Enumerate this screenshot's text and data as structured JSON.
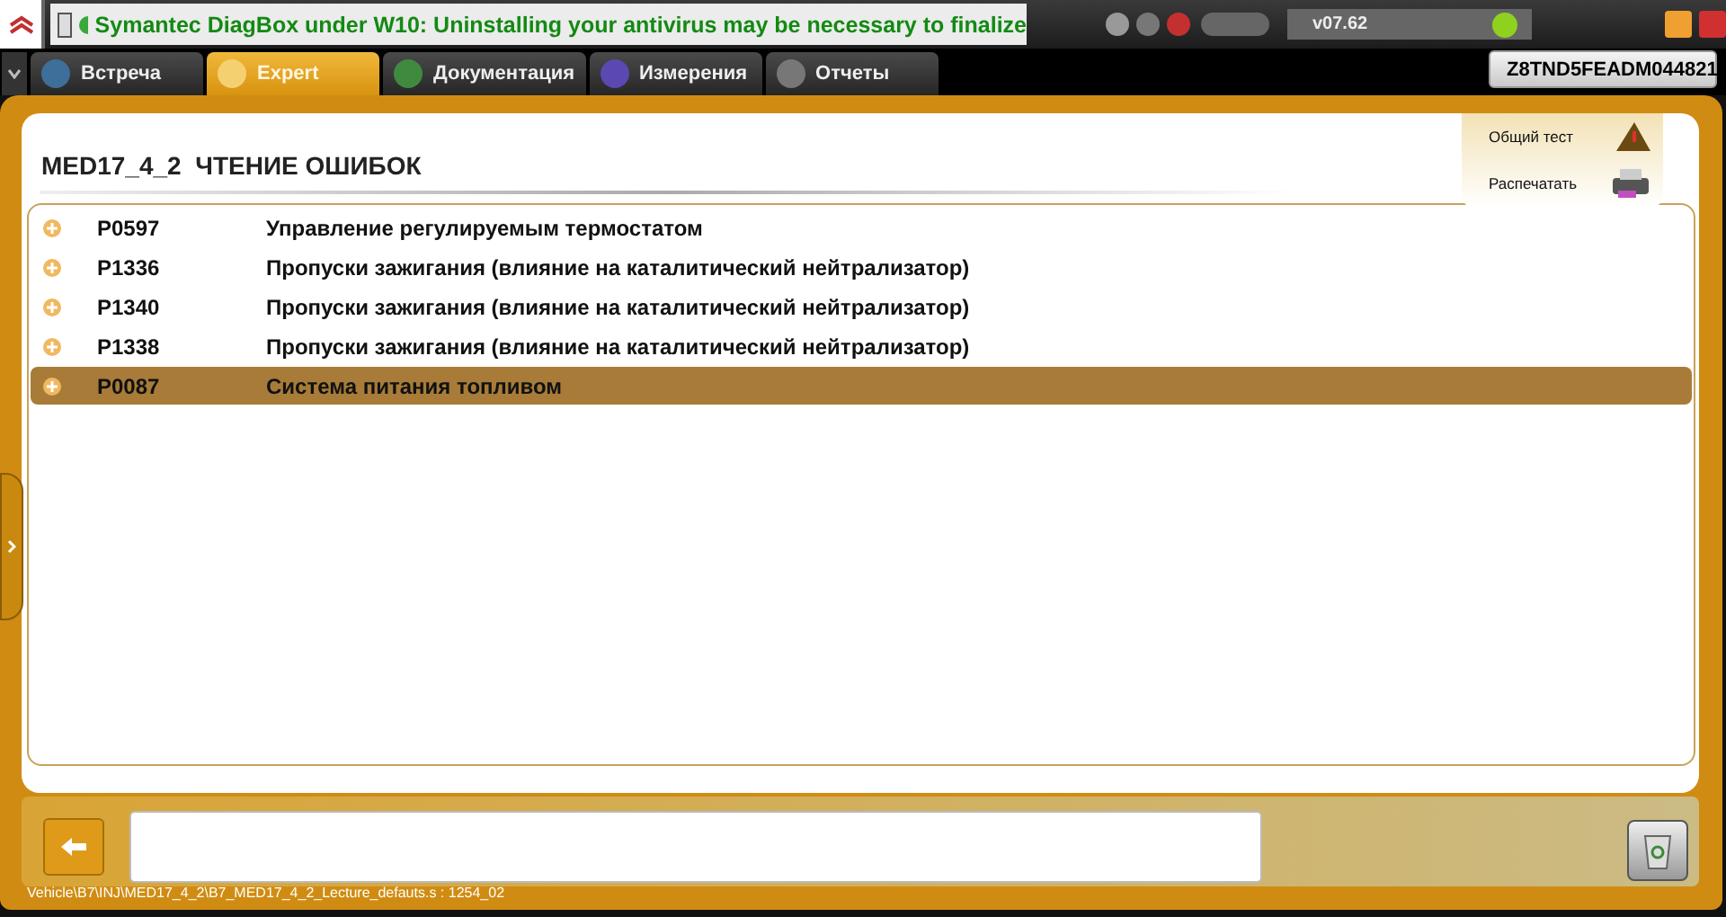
{
  "banner": {
    "text": "Symantec DiagBox under W10: Uninstalling your antivirus may be necessary to finalize"
  },
  "version": "v07.62",
  "tabs": [
    {
      "label": "Встреча",
      "selected": false
    },
    {
      "label": "Expert",
      "selected": true
    },
    {
      "label": "Документация",
      "selected": false
    },
    {
      "label": "Измерения",
      "selected": false
    },
    {
      "label": "Отчеты",
      "selected": false
    }
  ],
  "vin_button": "Z8TND5FEADM044821",
  "menu": [
    {
      "label": "Общий тест"
    },
    {
      "label": "Распечатать"
    }
  ],
  "page_title": "MED17_4_2  ЧТЕНИЕ ОШИБОК",
  "faults": [
    {
      "code": "P0597",
      "description": "Управление регулируемым термостатом",
      "selected": false
    },
    {
      "code": "P1336",
      "description": "Пропуски зажигания (влияние на каталитический нейтрализатор)",
      "selected": false
    },
    {
      "code": "P1340",
      "description": "Пропуски зажигания (влияние на каталитический нейтрализатор)",
      "selected": false
    },
    {
      "code": "P1338",
      "description": "Пропуски зажигания (влияние на каталитический нейтрализатор)",
      "selected": false
    },
    {
      "code": "P0087",
      "description": "Система питания топливом",
      "selected": true
    }
  ],
  "status_path": "Vehicle\\B7\\INJ\\MED17_4_2\\B7_MED17_4_2_Lecture_defauts.s : 1254_02"
}
